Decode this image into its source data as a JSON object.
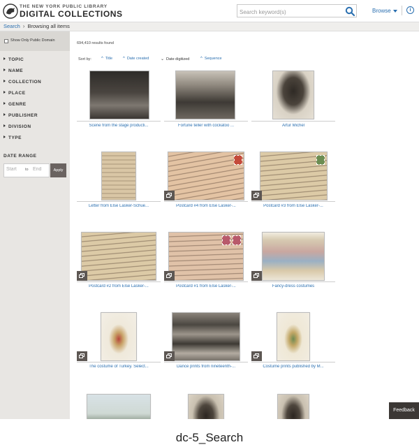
{
  "header": {
    "brand_top": "THE NEW YORK PUBLIC LIBRARY",
    "brand_main": "DIGITAL COLLECTIONS",
    "search_placeholder": "Search keyword(s)",
    "browse_label": "Browse",
    "logo_icon": "lion-logo-icon",
    "search_icon": "magnifier-icon",
    "info_icon": "info-circle-icon",
    "info_glyph": "i"
  },
  "breadcrumb": {
    "search_label": "Search",
    "separator": "›",
    "current": "Browsing all items"
  },
  "sidebar": {
    "public_domain_label": "Show Only Public Domain",
    "facets": [
      "TOPIC",
      "NAME",
      "COLLECTION",
      "PLACE",
      "GENRE",
      "PUBLISHER",
      "DIVISION",
      "TYPE"
    ],
    "date_range_title": "DATE RANGE",
    "start_placeholder": "Start",
    "end_placeholder": "End",
    "to_label": "to",
    "apply_label": "Apply"
  },
  "main": {
    "results_count": "694,410 results found",
    "sort_label": "Sort by:",
    "sort_options": [
      {
        "label": "Title",
        "arrow": "^"
      },
      {
        "label": "Date created",
        "arrow": "^"
      },
      {
        "label": "Date digitized",
        "arrow": "v"
      },
      {
        "label": "Sequence",
        "arrow": "^"
      }
    ],
    "items": [
      {
        "caption": "Scene from the stage producti...",
        "multi": false
      },
      {
        "caption": "Fortune teller with cockatoo ...",
        "multi": false
      },
      {
        "caption": "Artur Michel",
        "multi": false
      },
      {
        "caption": "Letter from Else Lasker-Schue...",
        "multi": false
      },
      {
        "caption": "Postcard #4 from Else Lasker-...",
        "multi": true
      },
      {
        "caption": "Postcard #3 from Else Lasker-...",
        "multi": true
      },
      {
        "caption": "Postcard #2 from Else Lasker-...",
        "multi": true
      },
      {
        "caption": "Postcard #1 from Else Lasker-...",
        "multi": true
      },
      {
        "caption": "Fancy-dress costumes",
        "multi": true
      },
      {
        "caption": "The costume of Turkey. Select...",
        "multi": true
      },
      {
        "caption": "Dance prints from nineteenth-...",
        "multi": true
      },
      {
        "caption": "Costume prints published by M...",
        "multi": true
      },
      {
        "caption": "",
        "multi": false
      },
      {
        "caption": "",
        "multi": false
      },
      {
        "caption": "",
        "multi": false
      }
    ],
    "multi_icon": "multiple-images-icon"
  },
  "feedback_label": "Feedback",
  "page_label": "dc-5_Search"
}
